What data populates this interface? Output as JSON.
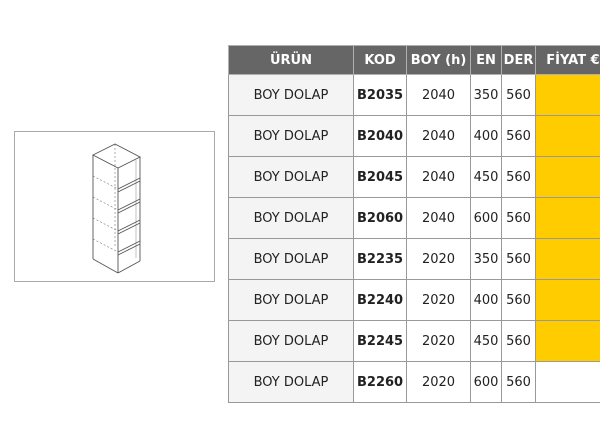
{
  "table": {
    "headers": {
      "urun": "ÜRÜN",
      "kod": "KOD",
      "boy": "BOY (h)",
      "en": "EN",
      "der": "DER",
      "fiyat": "FİYAT €"
    },
    "rows": [
      {
        "urun": "BOY DOLAP",
        "kod": "B2035",
        "boy": "2040",
        "en": "350",
        "der": "560",
        "price_highlighted": true
      },
      {
        "urun": "BOY DOLAP",
        "kod": "B2040",
        "boy": "2040",
        "en": "400",
        "der": "560",
        "price_highlighted": true
      },
      {
        "urun": "BOY DOLAP",
        "kod": "B2045",
        "boy": "2040",
        "en": "450",
        "der": "560",
        "price_highlighted": true
      },
      {
        "urun": "BOY DOLAP",
        "kod": "B2060",
        "boy": "2040",
        "en": "600",
        "der": "560",
        "price_highlighted": true
      },
      {
        "urun": "BOY DOLAP",
        "kod": "B2235",
        "boy": "2020",
        "en": "350",
        "der": "560",
        "price_highlighted": true
      },
      {
        "urun": "BOY DOLAP",
        "kod": "B2240",
        "boy": "2020",
        "en": "400",
        "der": "560",
        "price_highlighted": true
      },
      {
        "urun": "BOY DOLAP",
        "kod": "B2245",
        "boy": "2020",
        "en": "450",
        "der": "560",
        "price_highlighted": true
      },
      {
        "urun": "BOY DOLAP",
        "kod": "B2260",
        "boy": "2020",
        "en": "600",
        "der": "560",
        "price_highlighted": false
      }
    ]
  },
  "product_image": {
    "icon": "tall-cabinet-line-drawing"
  },
  "colors": {
    "header_bg": "#666666",
    "header_text": "#ffffff",
    "highlight": "#ffcc00",
    "product_cell_bg": "#f4f4f4",
    "border": "#999999",
    "drawing_stroke": "#555555"
  }
}
